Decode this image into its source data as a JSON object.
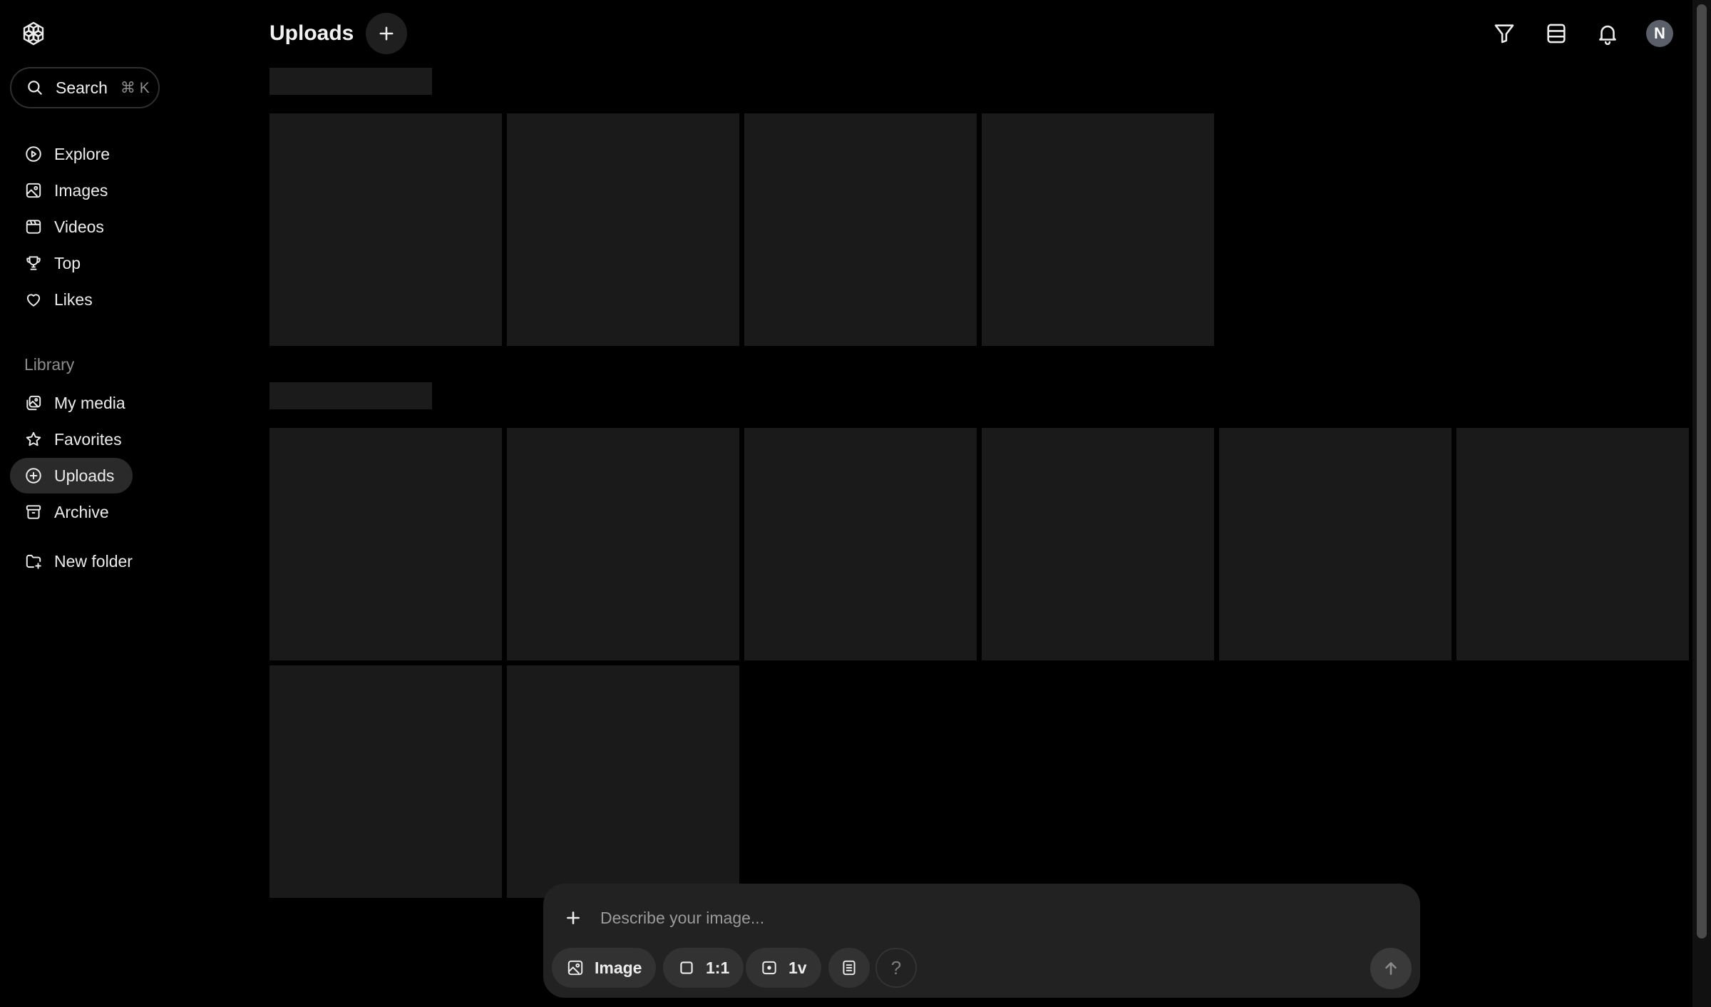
{
  "sidebar": {
    "search": {
      "label": "Search",
      "shortcut": "⌘ K"
    },
    "main_nav": [
      {
        "label": "Explore",
        "icon": "explore-icon"
      },
      {
        "label": "Images",
        "icon": "images-icon"
      },
      {
        "label": "Videos",
        "icon": "videos-icon"
      },
      {
        "label": "Top",
        "icon": "trophy-icon"
      },
      {
        "label": "Likes",
        "icon": "heart-icon"
      }
    ],
    "library_label": "Library",
    "library_nav": [
      {
        "label": "My media",
        "icon": "my-media-icon"
      },
      {
        "label": "Favorites",
        "icon": "star-icon"
      },
      {
        "label": "Uploads",
        "icon": "plus-circle-icon",
        "active": true
      },
      {
        "label": "Archive",
        "icon": "archive-icon"
      }
    ],
    "new_folder_label": "New folder"
  },
  "header": {
    "title": "Uploads",
    "avatar_initial": "N"
  },
  "composer": {
    "placeholder": "Describe your image...",
    "type_label": "Image",
    "aspect_label": "1:1",
    "variations_label": "1v",
    "help_label": "?"
  }
}
